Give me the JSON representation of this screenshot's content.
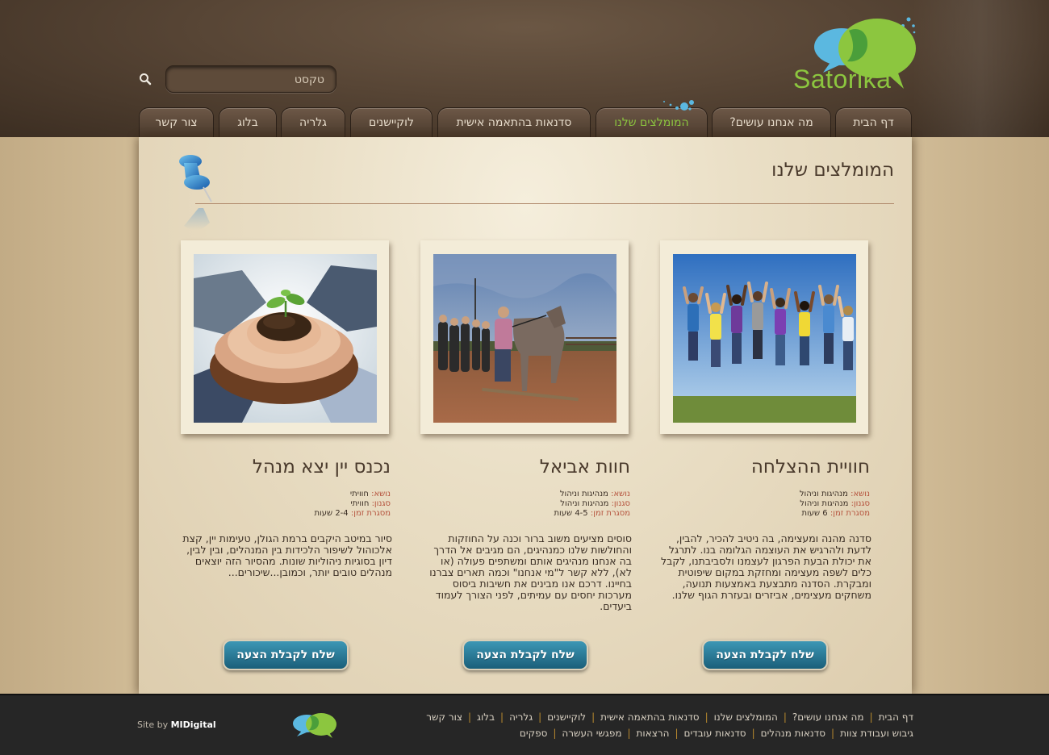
{
  "brand": {
    "name": "Satorika"
  },
  "search": {
    "value": "טקסט"
  },
  "nav": {
    "home": "דף הבית",
    "what_we_do": "מה אנחנו עושים?",
    "recommended": "המומלצים שלנו",
    "custom_workshops": "סדנאות בהתאמה אישית",
    "locations": "לוקיישנים",
    "gallery": "גלריה",
    "blog": "בלוג",
    "contact": "צור קשר"
  },
  "page": {
    "title": "המומלצים שלנו"
  },
  "cards": [
    {
      "title": "חוויית ההצלחה",
      "topic_label": "נושא:",
      "topic": "מנהיגות וניהול",
      "style_label": "סגנון:",
      "style": "מנהיגות וניהול",
      "time_label": "מסגרת זמן:",
      "time": "6 שעות",
      "description": "סדנה מהנה ומעצימה, בה ניטיב להכיר, להבין, לדעת ולהרגיש את העוצמה הגלומה בנו. לתרגל את יכולת הבעת הפרגון לעצמנו ולסביבתנו, לקבל כלים לשפה מעצימה ומחזקת במקום שיפוטית ומבקרת. הסדנה מתבצעת באמצעות תנועה, משחקים מעצימים, אביזרים ובעזרת הגוף שלנו.",
      "cta": "שלח לקבלת הצעה"
    },
    {
      "title": "חוות אביאל",
      "topic_label": "נושא:",
      "topic": "מנהיגות וניהול",
      "style_label": "סגנון:",
      "style": "מנהיגות וניהול",
      "time_label": "מסגרת זמן:",
      "time": "4-5 שעות",
      "description": "סוסים מציעים משוב ברור וכנה על החוזקות והחולשות שלנו כמנהיגים, הם מגיבים אל הדרך בה אנחנו מנהיגים אותם ומשתפים פעולה (או לא), ללא קשר ל\"מי אנחנו\" וכמה תארים צברנו בחיינו. דרכם אנו מבינים את חשיבות ביסוס מערכות יחסים עם עמיתים, לפני הצורך לעמוד ביעדים.",
      "cta": "שלח לקבלת הצעה"
    },
    {
      "title": "נכנס יין יצא מנהל",
      "topic_label": "נושא:",
      "topic": "חוויתי",
      "style_label": "סגנון:",
      "style": "חוויתי",
      "time_label": "מסגרת זמן:",
      "time": "2-4 שעות",
      "description": "סיור במיטב היקבים ברמת הגולן, טעימות יין, קצת אלכוהול לשיפור הלכידות בין המנהלים, ובין לבין, דיון בסוגיות ניהוליות שונות. מהסיור הזה יוצאים מנהלים טובים יותר, וכמובן...שיכורים...",
      "cta": "שלח לקבלת הצעה"
    }
  ],
  "footer": {
    "row1": [
      "דף הבית",
      "מה אנחנו עושים?",
      "המומלצים שלנו",
      "סדנאות בהתאמה אישית",
      "לוקיישנים",
      "גלריה",
      "בלוג",
      "צור קשר"
    ],
    "row2": [
      "גיבוש ועבודת צוות",
      "סדנאות מנהלים",
      "סדנאות עובדים",
      "הרצאות",
      "מפגשי העשרה",
      "ספקים"
    ],
    "site_by_label": "Site by",
    "site_by_name": "MIDigital"
  },
  "colors": {
    "brand_green": "#8cc63f",
    "brand_blue": "#5bb8e0",
    "header_brown": "#574535",
    "cta_blue": "#1f6a86",
    "meta_label": "#b5523c"
  }
}
